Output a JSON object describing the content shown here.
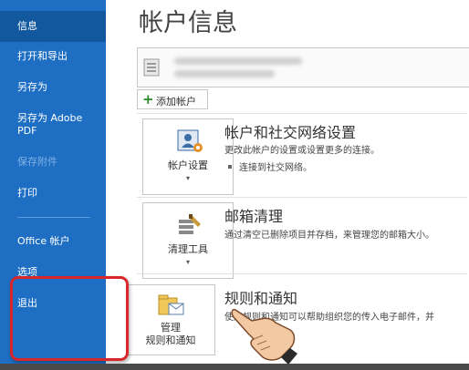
{
  "sidebar": {
    "items": [
      {
        "label": "信息"
      },
      {
        "label": "打开和导出"
      },
      {
        "label": "另存为"
      },
      {
        "label": "另存为 Adobe PDF"
      },
      {
        "label": "保存附件"
      },
      {
        "label": "打印"
      },
      {
        "label": "Office 帐户"
      },
      {
        "label": "选项"
      },
      {
        "label": "退出"
      }
    ]
  },
  "page_title": "帐户信息",
  "add_account": {
    "label": "添加帐户"
  },
  "sections": [
    {
      "tile_label": "帐户设置",
      "title": "帐户和社交网络设置",
      "desc": "更改此帐户的设置或设置更多的连接。",
      "bullet": "连接到社交网络。"
    },
    {
      "tile_label": "清理工具",
      "title": "邮箱清理",
      "desc": "通过清空已删除项目并存档，来管理您的邮箱大小。"
    },
    {
      "tile_label_line1": "管理",
      "tile_label_line2": "规则和通知",
      "title": "规则和通知",
      "desc": "使用规则和通知可以帮助组织您的传入电子邮件，并"
    }
  ],
  "colors": {
    "sidebar_bg": "#1e6fc4",
    "sidebar_active": "#12589f",
    "highlight": "#d9262a"
  }
}
